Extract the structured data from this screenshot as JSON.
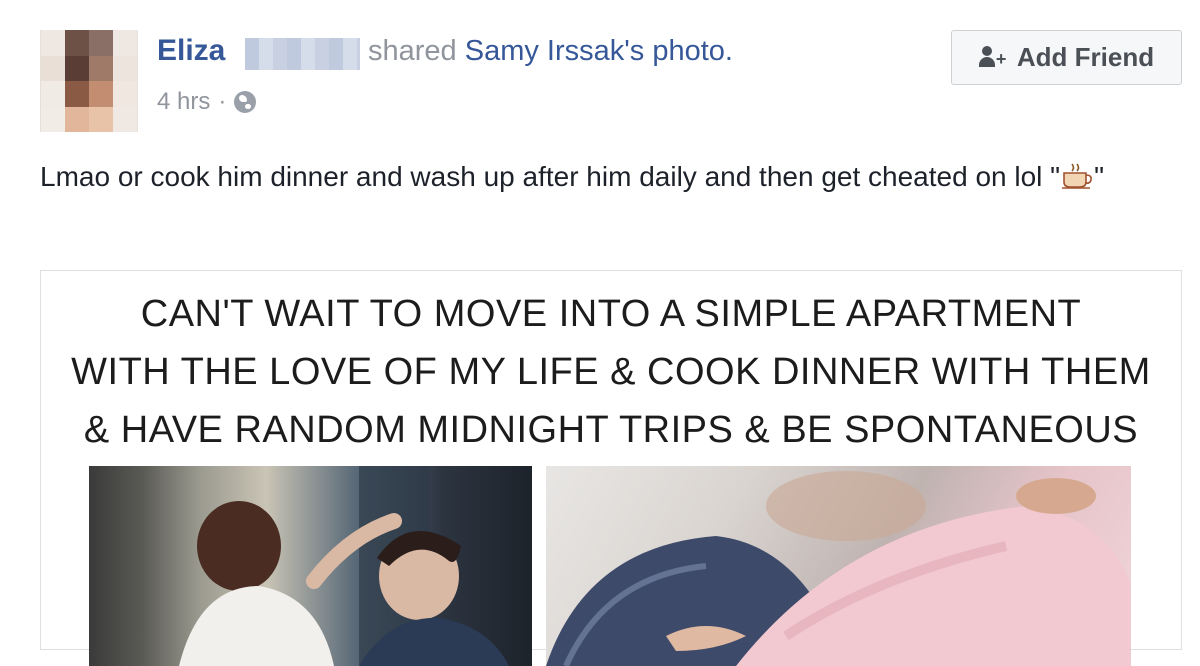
{
  "post": {
    "author_name": "Eliza",
    "shared_text": "shared",
    "shared_link": "Samy Irssak's photo.",
    "time": "4 hrs",
    "separator": "·",
    "privacy_icon": "globe-icon",
    "message": "Lmao or cook him dinner and wash up after him daily and then get cheated on lol \"",
    "message_end": "\"",
    "emoji_icon": "coffee-cup-icon"
  },
  "actions": {
    "add_friend_label": "Add Friend",
    "add_friend_icon": "add-friend-icon"
  },
  "image": {
    "caption_line1": "CAN'T WAIT TO MOVE INTO A SIMPLE APARTMENT",
    "caption_line2": "WITH THE LOVE OF MY LIFE & COOK DINNER WITH THEM",
    "caption_line3": "& HAVE RANDOM MIDNIGHT TRIPS & BE SPONTANEOUS"
  },
  "colors": {
    "link": "#365899",
    "meta": "#90949c",
    "text": "#1d2129",
    "button_bg": "#f6f7f9",
    "button_border": "#ced0d4"
  }
}
